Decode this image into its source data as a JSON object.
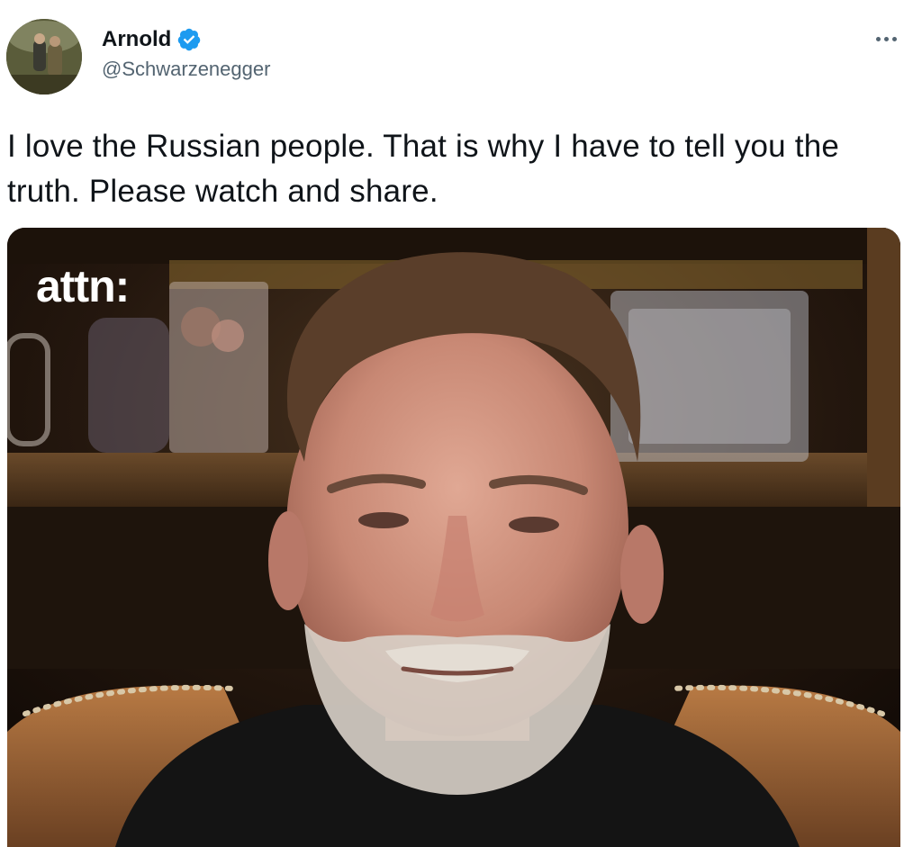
{
  "tweet": {
    "author": {
      "display_name": "Arnold",
      "handle": "@Schwarzenegger",
      "verified": true
    },
    "text": "I love the Russian people. That is why I have to tell you the truth. Please watch and share.",
    "media": {
      "watermark": "attn:"
    }
  },
  "icons": {
    "avatar": "avatar",
    "verified": "verified-badge-icon",
    "more": "more-options-icon"
  },
  "colors": {
    "verified_blue": "#1d9bf0",
    "text_primary": "#0f1419",
    "text_secondary": "#536471"
  }
}
